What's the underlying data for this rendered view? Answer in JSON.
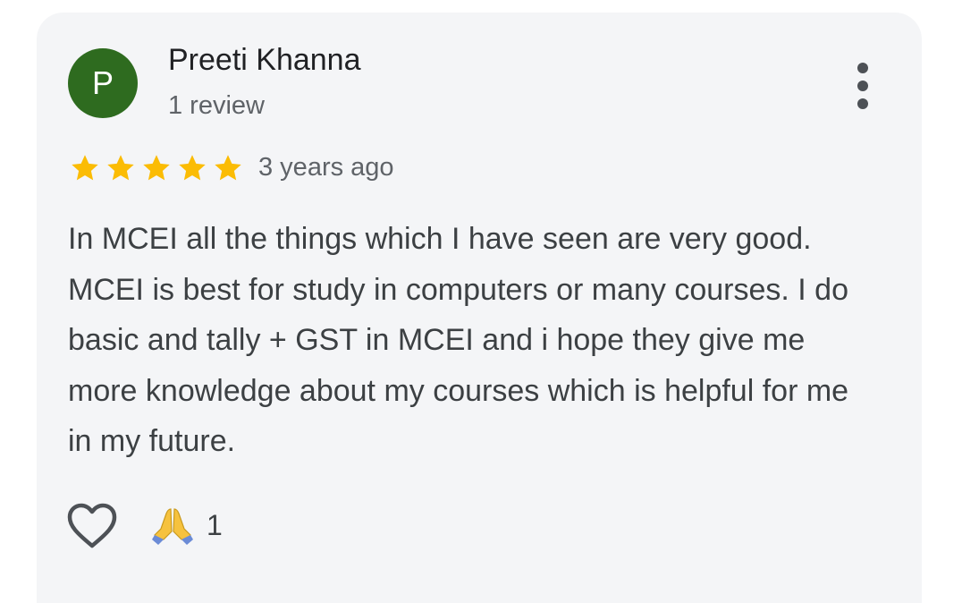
{
  "review": {
    "author": {
      "initial": "P",
      "name": "Preeti Khanna",
      "review_count": "1 review",
      "avatar_color": "#2e6b1f"
    },
    "rating": 5,
    "rating_max": 5,
    "star_color": "#fbbc04",
    "time_ago": "3 years ago",
    "text": "In MCEI all the things which I have seen are very good. MCEI is best for study in computers or many courses. I do basic and tally + GST in MCEI and i hope they give me more knowledge about my courses which is helpful for me in my future.",
    "actions": {
      "like_icon": "heart-outline-icon",
      "reaction_icon": "folded-hands-emoji",
      "reaction_count": "1"
    },
    "menu_icon": "more-vertical-icon"
  }
}
